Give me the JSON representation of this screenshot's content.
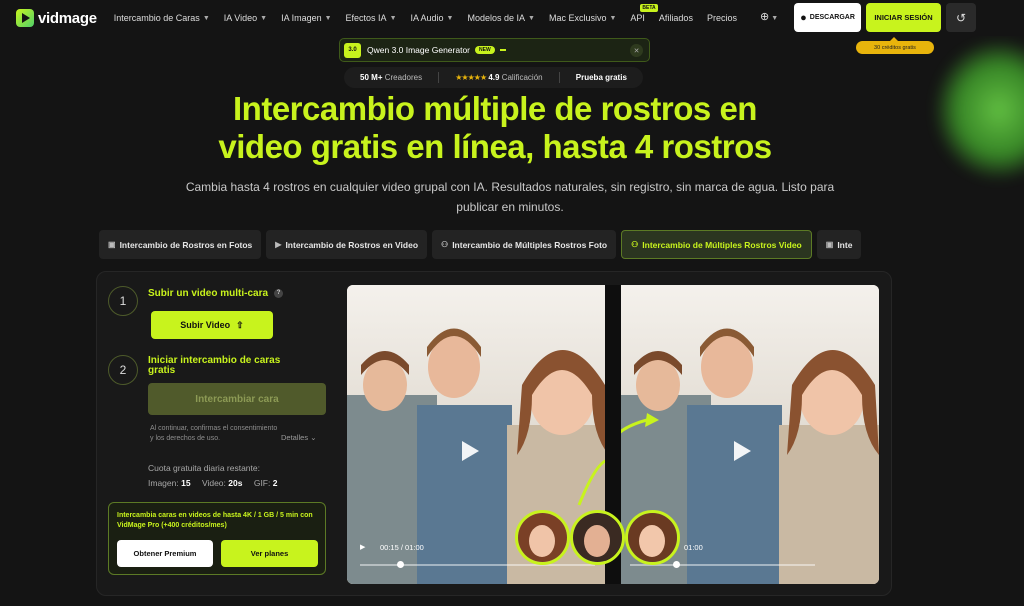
{
  "brand": {
    "name": "vidmage"
  },
  "nav": {
    "items": [
      {
        "label": "Intercambio de Caras",
        "has_dropdown": true
      },
      {
        "label": "IA Video",
        "has_dropdown": true
      },
      {
        "label": "IA Imagen",
        "has_dropdown": true
      },
      {
        "label": "Efectos IA",
        "has_dropdown": true
      },
      {
        "label": "IA Audio",
        "has_dropdown": true
      },
      {
        "label": "Modelos de IA",
        "has_dropdown": true
      },
      {
        "label": "Mac Exclusivo",
        "has_dropdown": true
      },
      {
        "label": "API",
        "has_dropdown": false,
        "badge": "BETA"
      },
      {
        "label": "Afiliados",
        "has_dropdown": false
      },
      {
        "label": "Precios",
        "has_dropdown": false
      }
    ],
    "download_label": "DESCARGAR",
    "login_label": "INICIAR SESIÓN",
    "credits_badge": "30 créditos gratis"
  },
  "promo": {
    "tag": "3.0",
    "title": "Qwen 3.0 Image Generator",
    "new_badge": "NEW"
  },
  "stats": {
    "creators_value": "50 M+",
    "creators_label": "Creadores",
    "stars": "★★★★★",
    "rating_value": "4.9",
    "rating_label": "Calificación",
    "trial": "Prueba gratis"
  },
  "hero": {
    "title_line1": "Intercambio múltiple de rostros en",
    "title_line2": "video gratis en línea, hasta 4 rostros",
    "subtitle_line1": "Cambia hasta 4 rostros en cualquier video grupal con IA. Resultados naturales, sin registro, sin marca de agua. Listo para",
    "subtitle_line2": "publicar en minutos."
  },
  "tabs": [
    {
      "label": "Intercambio de Rostros en Fotos",
      "active": false
    },
    {
      "label": "Intercambio de Rostros en Video",
      "active": false
    },
    {
      "label": "Intercambio de Múltiples Rostros Foto",
      "active": false
    },
    {
      "label": "Intercambio de Múltiples Rostros Video",
      "active": true
    },
    {
      "label": "Inte",
      "active": false
    }
  ],
  "steps": {
    "step1_number": "1",
    "step1_title": "Subir un video multi-cara",
    "upload_label": "Subir Video",
    "step2_number": "2",
    "step2_title_line1": "Iniciar intercambio de caras",
    "step2_title_line2": "gratis",
    "swap_label": "Intercambiar cara"
  },
  "consent": {
    "text": "Al continuar, confirmas el consentimiento y los derechos de uso.",
    "details_label": "Detalles"
  },
  "quota": {
    "label": "Cuota gratuita diaria restante:",
    "image_label": "Imagen:",
    "image_value": "15",
    "video_label": "Video:",
    "video_value": "20s",
    "gif_label": "GIF:",
    "gif_value": "2"
  },
  "pro": {
    "text": "Intercambia caras en videos de hasta 4K / 1 GB / 5 min con VidMage Pro (+400 créditos/mes)",
    "premium_label": "Obtener Premium",
    "plans_label": "Ver planes"
  },
  "preview": {
    "left_time": "00:15 / 01:00",
    "right_time": "01:00"
  },
  "colors": {
    "accent": "#c8f31d",
    "background": "#141414",
    "panel": "#191919",
    "premium_badge": "#e8b40c"
  }
}
